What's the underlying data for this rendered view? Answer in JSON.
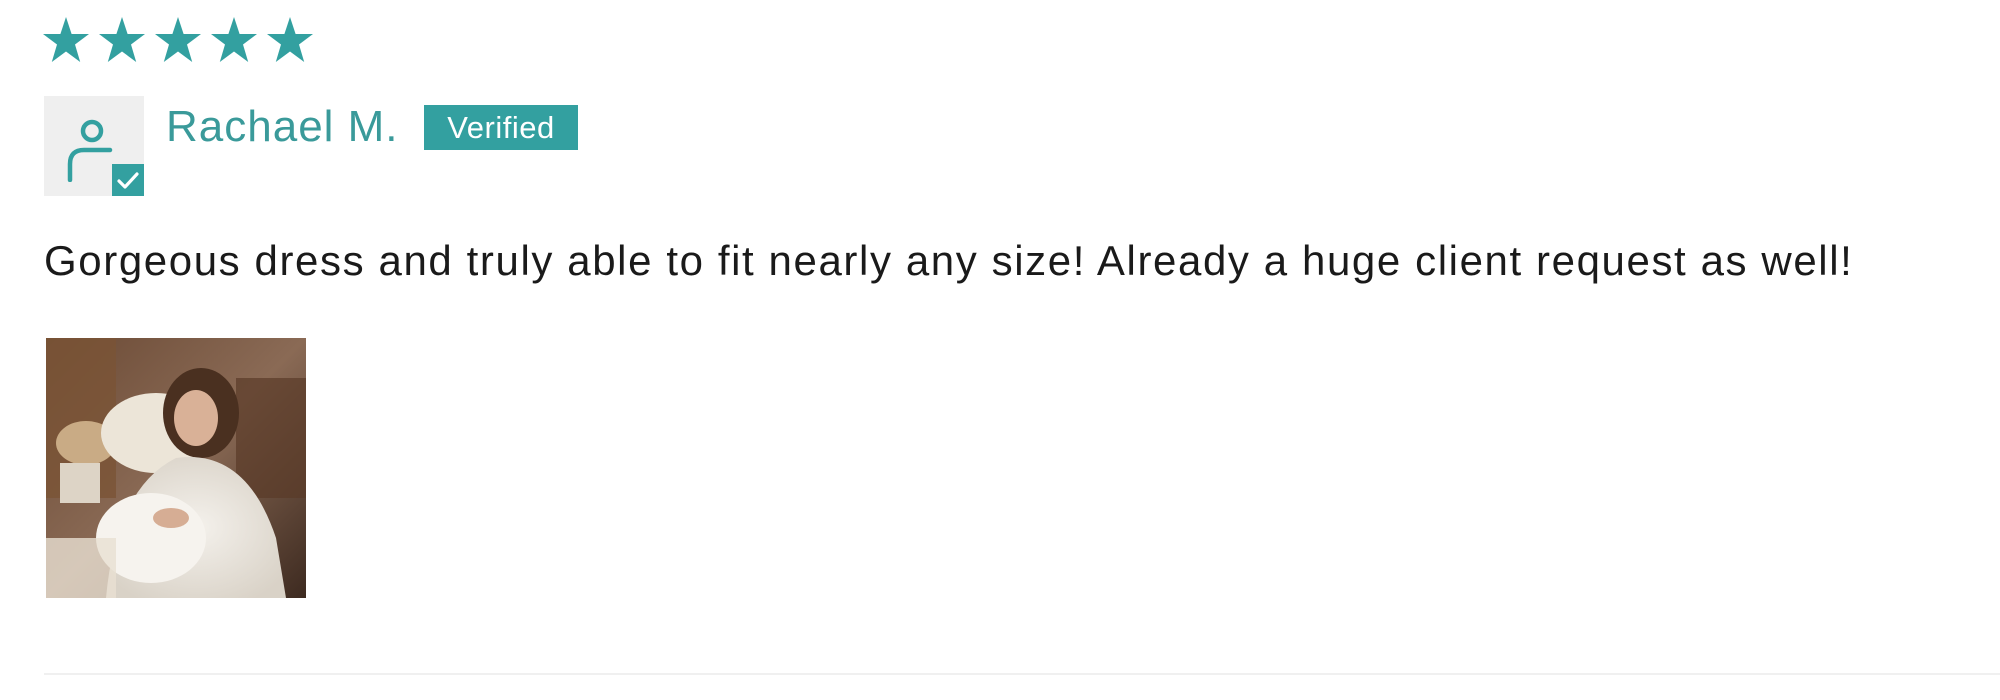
{
  "review": {
    "rating": 5,
    "rating_max": 5,
    "author": "Rachael M.",
    "verified_label": "Verified",
    "body": "Gorgeous dress and truly able to fit nearly any size! Already a huge client request as well!",
    "photo": {
      "subject": "review-photo"
    }
  },
  "icons": {
    "star": "star-icon",
    "avatar": "user-icon",
    "check": "check-icon"
  },
  "colors": {
    "accent": "#33a0a0",
    "accent_text": "#3a9a9a",
    "body_text": "#1a1a1a",
    "avatar_bg": "#efefef",
    "divider": "#f0f0f0"
  }
}
